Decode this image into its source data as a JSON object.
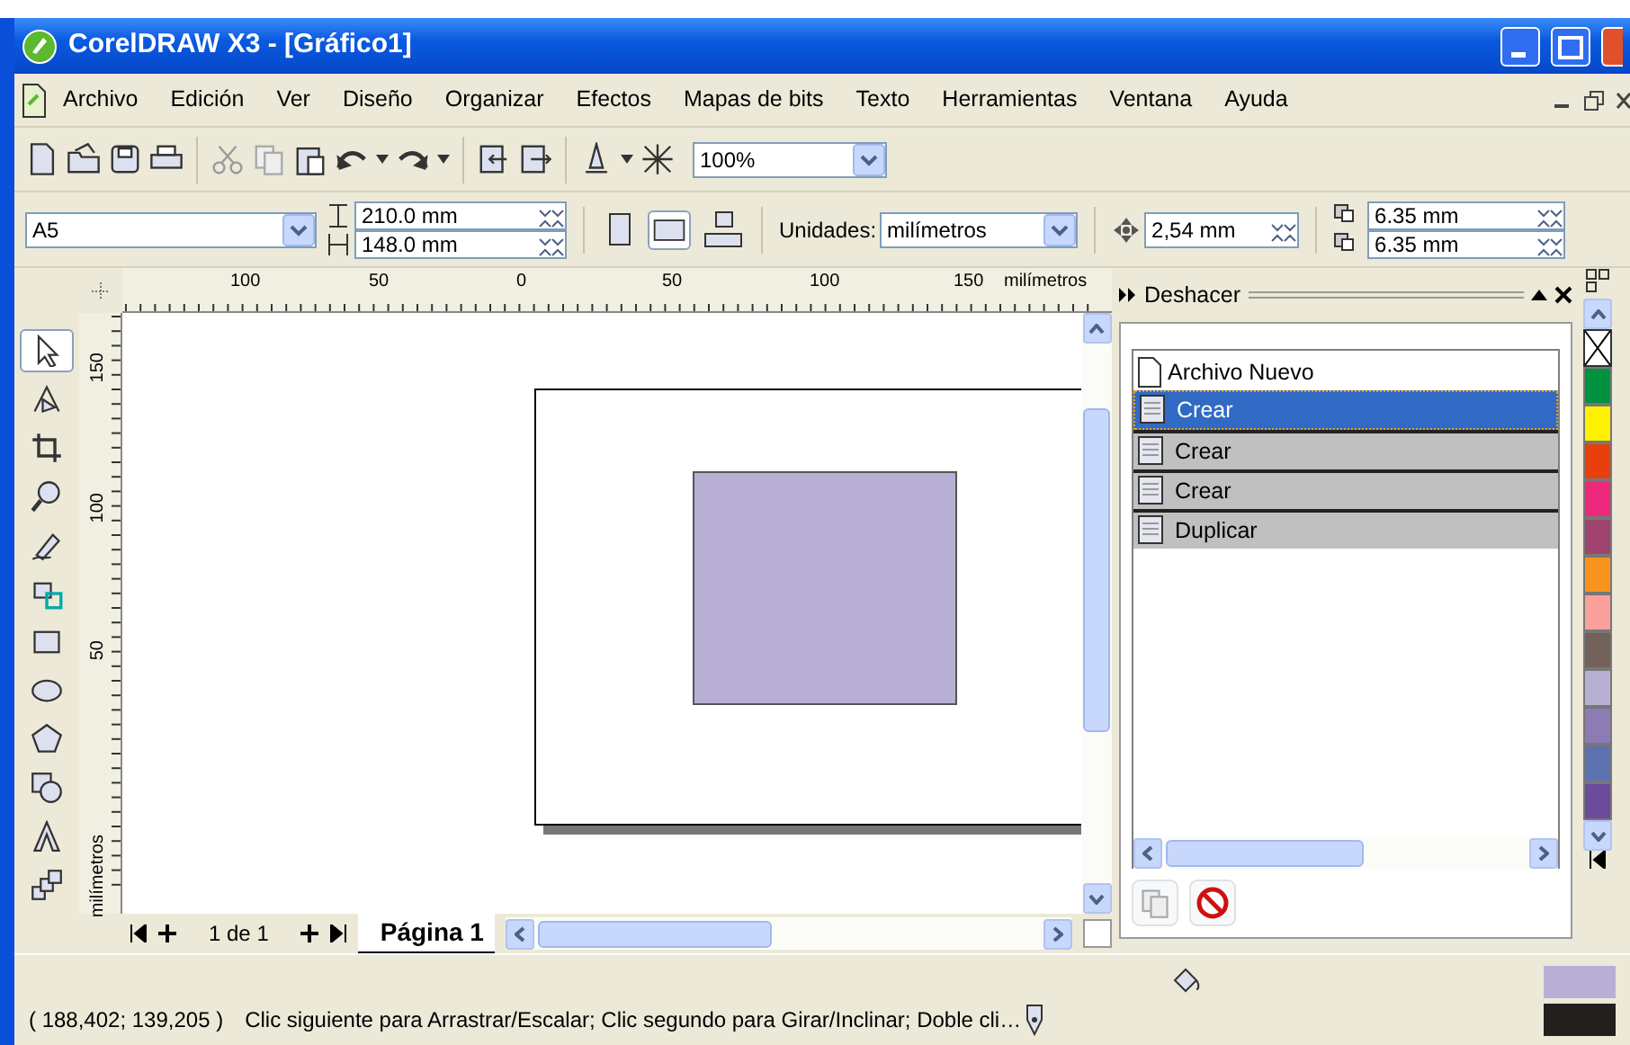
{
  "window": {
    "title": "CorelDRAW X3 - [Gráfico1]"
  },
  "menu": [
    "Archivo",
    "Edición",
    "Ver",
    "Diseño",
    "Organizar",
    "Efectos",
    "Mapas de bits",
    "Texto",
    "Herramientas",
    "Ventana",
    "Ayuda"
  ],
  "zoom": {
    "value": "100%"
  },
  "property_bar": {
    "paper": "A5",
    "width": "210.0 mm",
    "height": "148.0 mm",
    "landscape": true,
    "units_label": "Unidades:",
    "units": "milímetros",
    "nudge": "2,54 mm",
    "dup_x": "6.35 mm",
    "dup_y": "6.35 mm"
  },
  "rulers": {
    "horizontal_labels": [
      "100",
      "50",
      "0",
      "50",
      "100",
      "150"
    ],
    "horizontal_unit": "milímetros",
    "vertical_labels": [
      "150",
      "100",
      "50"
    ],
    "vertical_unit": "milímetros"
  },
  "tools": [
    {
      "kind": "pick",
      "selected": true
    },
    {
      "kind": "shape",
      "selected": false
    },
    {
      "kind": "crop",
      "selected": false
    },
    {
      "kind": "zoom",
      "selected": false
    },
    {
      "kind": "freehand",
      "selected": false
    },
    {
      "kind": "smartfill",
      "selected": false
    },
    {
      "kind": "rectangle",
      "selected": false
    },
    {
      "kind": "ellipse",
      "selected": false
    },
    {
      "kind": "polygon",
      "selected": false
    },
    {
      "kind": "shapes",
      "selected": false
    },
    {
      "kind": "text",
      "selected": false
    },
    {
      "kind": "blend",
      "selected": false
    }
  ],
  "pages": {
    "count": "1 de 1",
    "tab": "Página 1"
  },
  "docker": {
    "title": "Deshacer",
    "items": [
      {
        "label": "Archivo Nuevo",
        "kind": "file",
        "selected": false,
        "undone": false
      },
      {
        "label": "Crear",
        "kind": "action",
        "selected": true,
        "undone": false
      },
      {
        "label": "Crear",
        "kind": "action",
        "selected": false,
        "undone": true
      },
      {
        "label": "Crear",
        "kind": "action",
        "selected": false,
        "undone": true
      },
      {
        "label": "Duplicar",
        "kind": "action",
        "selected": false,
        "undone": true
      }
    ]
  },
  "palette": [
    {
      "kind": "none"
    },
    {
      "kind": "swatch",
      "color": "#00923f"
    },
    {
      "kind": "swatch",
      "color": "#fff200"
    },
    {
      "kind": "swatch",
      "color": "#e8400c"
    },
    {
      "kind": "swatch",
      "color": "#ec297b"
    },
    {
      "kind": "swatch",
      "color": "#a0436f"
    },
    {
      "kind": "swatch",
      "color": "#f7941d"
    },
    {
      "kind": "swatch",
      "color": "#f9a19a"
    },
    {
      "kind": "swatch",
      "color": "#72625a"
    },
    {
      "kind": "swatch",
      "color": "#b8b0d4"
    },
    {
      "kind": "swatch",
      "color": "#8d7bb5"
    },
    {
      "kind": "swatch",
      "color": "#5c72b0"
    },
    {
      "kind": "swatch",
      "color": "#6c4a9c"
    }
  ],
  "status": {
    "coords": "( 188,402; 139,205 )",
    "message": "Clic siguiente para Arrastrar/Escalar; Clic segundo para Girar/Inclinar; Doble cli…",
    "fill": {
      "color": "#b8b0d4"
    },
    "outline": {
      "color": "#231f1c"
    }
  }
}
